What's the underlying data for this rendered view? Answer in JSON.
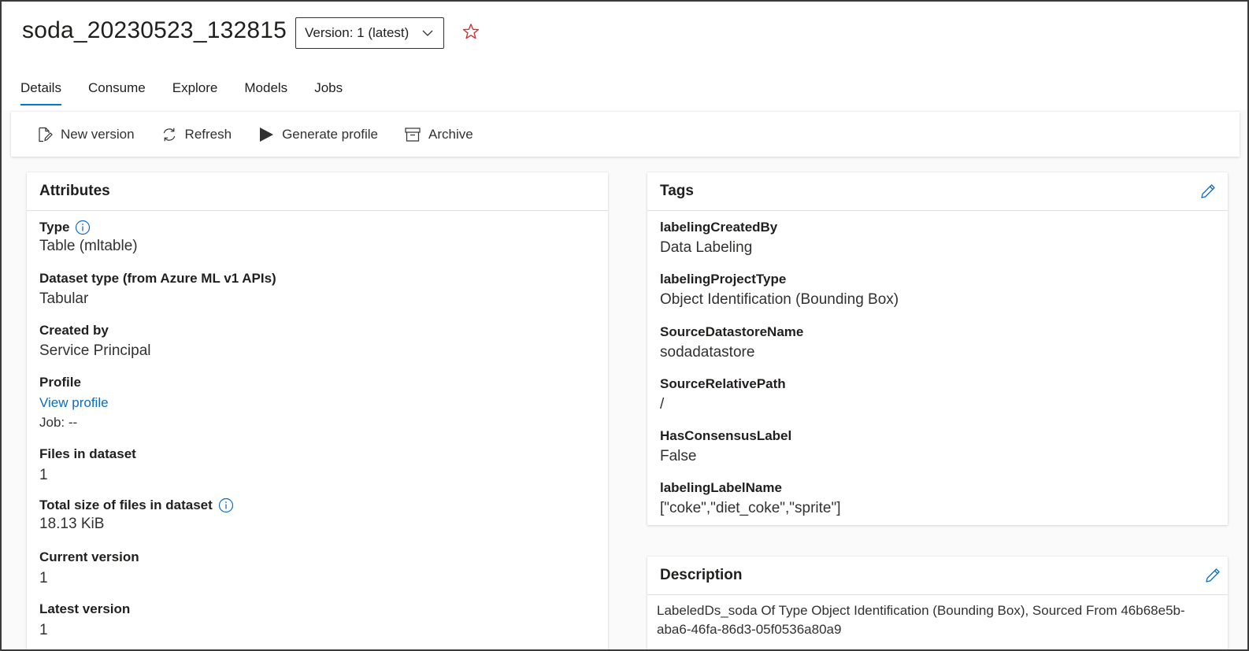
{
  "header": {
    "title": "soda_20230523_132815",
    "version_label": "Version: 1 (latest)"
  },
  "tabs": [
    {
      "label": "Details",
      "active": true
    },
    {
      "label": "Consume"
    },
    {
      "label": "Explore"
    },
    {
      "label": "Models"
    },
    {
      "label": "Jobs"
    }
  ],
  "toolbar": {
    "new_version": "New version",
    "refresh": "Refresh",
    "generate_profile": "Generate profile",
    "archive": "Archive"
  },
  "attributes": {
    "title": "Attributes",
    "type_label": "Type",
    "type_value": "Table (mltable)",
    "dataset_type_label": "Dataset type (from Azure ML v1 APIs)",
    "dataset_type_value": "Tabular",
    "created_by_label": "Created by",
    "created_by_value": "Service Principal",
    "profile_label": "Profile",
    "profile_link": "View profile",
    "profile_job": "Job: --",
    "files_label": "Files in dataset",
    "files_value": "1",
    "total_size_label": "Total size of files in dataset",
    "total_size_value": "18.13 KiB",
    "current_version_label": "Current version",
    "current_version_value": "1",
    "latest_version_label": "Latest version",
    "latest_version_value": "1"
  },
  "tags": {
    "title": "Tags",
    "items": [
      {
        "key": "labelingCreatedBy",
        "value": "Data Labeling"
      },
      {
        "key": "labelingProjectType",
        "value": "Object Identification (Bounding Box)"
      },
      {
        "key": "SourceDatastoreName",
        "value": "sodadatastore"
      },
      {
        "key": "SourceRelativePath",
        "value": "/"
      },
      {
        "key": "HasConsensusLabel",
        "value": "False"
      },
      {
        "key": "labelingLabelName",
        "value": "[\"coke\",\"diet_coke\",\"sprite\"]"
      }
    ]
  },
  "description": {
    "title": "Description",
    "line1": "LabeledDs_soda Of Type Object Identification (Bounding Box), Sourced From 46b68e5b-",
    "line2": "aba6-46fa-86d3-05f0536a80a9"
  },
  "colors": {
    "accent": "#0078d4",
    "link": "#0f6cbd",
    "star": "#d13438"
  }
}
